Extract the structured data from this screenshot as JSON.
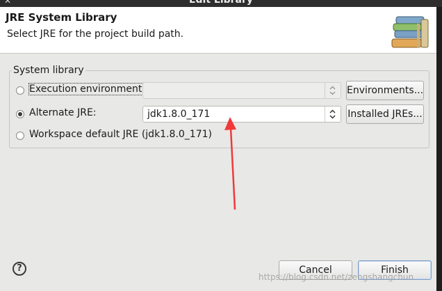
{
  "window": {
    "title": "Edit Library"
  },
  "header": {
    "title": "JRE System Library",
    "subtitle": "Select JRE for the project build path."
  },
  "group": {
    "legend": "System library",
    "options": [
      {
        "label": "Execution environment:",
        "selected": false
      },
      {
        "label": "Alternate JRE:",
        "selected": true
      },
      {
        "label": "Workspace default JRE (jdk1.8.0_171)",
        "selected": false
      }
    ],
    "execution_environment_value": "",
    "alternate_jre_value": "jdk1.8.0_171",
    "environments_button": "Environments...",
    "installed_jres_button": "Installed JREs..."
  },
  "footer": {
    "help_label": "?",
    "cancel_button": "Cancel",
    "finish_button": "Finish"
  },
  "watermark": "https://blog.csdn.net/zengshangchun",
  "colors": {
    "annotation_arrow": "#f03a3a",
    "header_bg": "#ffffff",
    "dialog_bg": "#e8e8e7"
  }
}
